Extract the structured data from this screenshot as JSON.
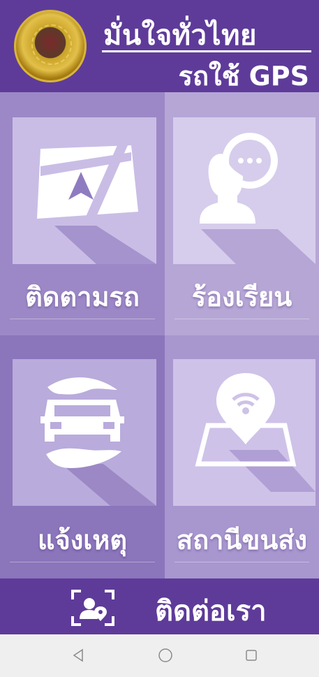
{
  "header": {
    "title": "มั่นใจทั่วไทย",
    "subtitle": "รถใช้ GPS",
    "logo_icon": "department-of-land-transport-emblem"
  },
  "menu": [
    {
      "label": "ติดตามรถ",
      "icon": "map-navigation-icon"
    },
    {
      "label": "ร้องเรียน",
      "icon": "person-chat-icon"
    },
    {
      "label": "แจ้งเหตุ",
      "icon": "hands-car-icon"
    },
    {
      "label": "สถานีขนส่ง",
      "icon": "map-pin-wifi-icon"
    }
  ],
  "footer": {
    "contact_label": "ติดต่อเรา",
    "contact_icon": "contact-person-location-icon"
  },
  "navigation_bar": {
    "back_icon": "back-triangle-icon",
    "home_icon": "home-circle-icon",
    "recents_icon": "recents-square-icon"
  },
  "colors": {
    "primary": "#5e3b99",
    "tile_light": "#c9bde5",
    "background": "#9c88c6"
  }
}
